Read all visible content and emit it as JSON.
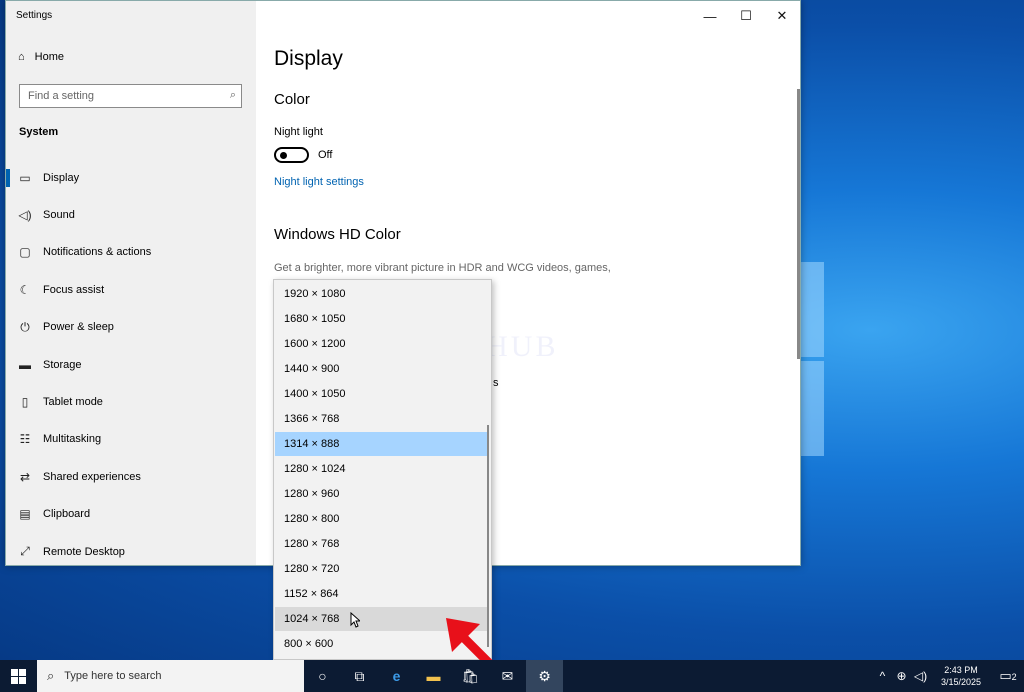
{
  "window": {
    "title": "Settings"
  },
  "sidebar": {
    "home": "Home",
    "search_placeholder": "Find a setting",
    "section": "System",
    "items": [
      {
        "label": "Display",
        "icon": "monitor-icon"
      },
      {
        "label": "Sound",
        "icon": "speaker-icon"
      },
      {
        "label": "Notifications & actions",
        "icon": "notification-icon"
      },
      {
        "label": "Focus assist",
        "icon": "moon-icon"
      },
      {
        "label": "Power & sleep",
        "icon": "power-icon"
      },
      {
        "label": "Storage",
        "icon": "storage-icon"
      },
      {
        "label": "Tablet mode",
        "icon": "tablet-icon"
      },
      {
        "label": "Multitasking",
        "icon": "multitasking-icon"
      },
      {
        "label": "Shared experiences",
        "icon": "shared-icon"
      },
      {
        "label": "Clipboard",
        "icon": "clipboard-icon"
      },
      {
        "label": "Remote Desktop",
        "icon": "remote-desktop-icon"
      }
    ]
  },
  "content": {
    "title": "Display",
    "color_heading": "Color",
    "night_light_label": "Night light",
    "night_light_state": "Off",
    "night_light_link": "Night light settings",
    "hdr_heading": "Windows HD Color",
    "hdr_description": "Get a brighter, more vibrant picture in HDR and WCG videos, games,",
    "partial_text": "s"
  },
  "watermark": "IT Pros HUB",
  "dropdown": {
    "options": [
      "1920 × 1080",
      "1680 × 1050",
      "1600 × 1200",
      "1440 × 900",
      "1400 × 1050",
      "1366 × 768",
      "1314 × 888",
      "1280 × 1024",
      "1280 × 960",
      "1280 × 800",
      "1280 × 768",
      "1280 × 720",
      "1152 × 864",
      "1024 × 768",
      "800 × 600"
    ],
    "selected": "1314 × 888",
    "hovered": "1024 × 768"
  },
  "taskbar": {
    "search_placeholder": "Type here to search",
    "time": "2:43 PM",
    "date": "3/15/2025",
    "notification_count": "2"
  },
  "colors": {
    "accent": "#0063b1",
    "selected": "#a6d4ff",
    "taskbar": "#0c1b33"
  }
}
